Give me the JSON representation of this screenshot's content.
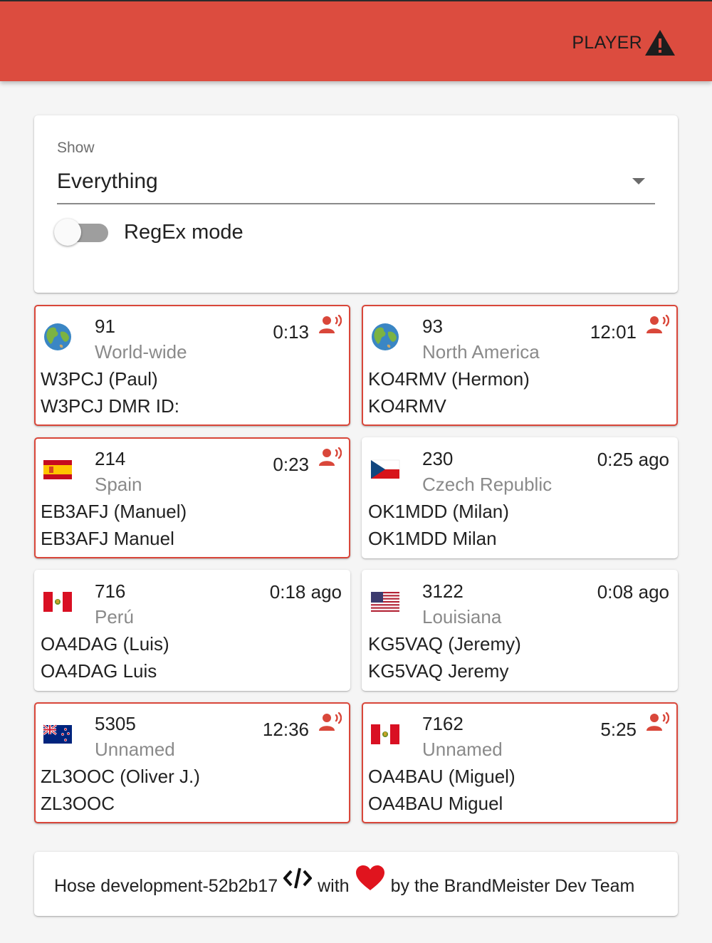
{
  "header": {
    "player_label": "PLAYER",
    "player_icon": "warning-icon",
    "bar_color": "#dc4c3f"
  },
  "filter": {
    "show_label": "Show",
    "selected": "Everything",
    "regex_label": "RegEx mode",
    "regex_enabled": false
  },
  "talkgroups": [
    {
      "number": "91",
      "region": "World-wide",
      "flag": "globe",
      "time": "0:13",
      "active": true,
      "line1": "W3PCJ (Paul)",
      "line2": "W3PCJ DMR ID:"
    },
    {
      "number": "93",
      "region": "North America",
      "flag": "globe",
      "time": "12:01",
      "active": true,
      "line1": "KO4RMV (Hermon)",
      "line2": "KO4RMV"
    },
    {
      "number": "214",
      "region": "Spain",
      "flag": "spain",
      "time": "0:23",
      "active": true,
      "line1": "EB3AFJ (Manuel)",
      "line2": "EB3AFJ Manuel"
    },
    {
      "number": "230",
      "region": "Czech Republic",
      "flag": "czech",
      "time": "0:25 ago",
      "active": false,
      "line1": "OK1MDD (Milan)",
      "line2": "OK1MDD Milan"
    },
    {
      "number": "716",
      "region": "Perú",
      "flag": "peru",
      "time": "0:18 ago",
      "active": false,
      "line1": "OA4DAG (Luis)",
      "line2": "OA4DAG Luis"
    },
    {
      "number": "3122",
      "region": "Louisiana",
      "flag": "usa",
      "time": "0:08 ago",
      "active": false,
      "line1": "KG5VAQ (Jeremy)",
      "line2": "KG5VAQ Jeremy"
    },
    {
      "number": "5305",
      "region": "Unnamed",
      "flag": "newzealand",
      "time": "12:36",
      "active": true,
      "line1": "ZL3OOC (Oliver J.)",
      "line2": "ZL3OOC"
    },
    {
      "number": "7162",
      "region": "Unnamed",
      "flag": "peru",
      "time": "5:25",
      "active": true,
      "line1": "OA4BAU (Miguel)",
      "line2": "OA4BAU Miguel"
    }
  ],
  "footer": {
    "prefix": "Hose development-52b2b17",
    "with": "with",
    "suffix": "by the BrandMeister Dev Team",
    "code_icon": "code-icon",
    "heart_icon": "heart-icon",
    "heart_color": "#e0141e"
  }
}
